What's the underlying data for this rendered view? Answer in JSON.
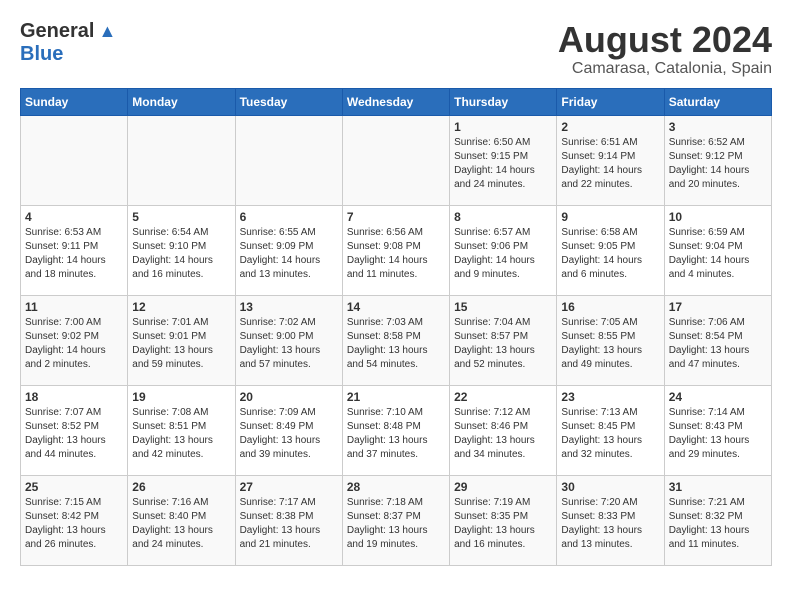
{
  "header": {
    "logo_general": "General",
    "logo_blue": "Blue",
    "main_title": "August 2024",
    "subtitle": "Camarasa, Catalonia, Spain"
  },
  "calendar": {
    "days_of_week": [
      "Sunday",
      "Monday",
      "Tuesday",
      "Wednesday",
      "Thursday",
      "Friday",
      "Saturday"
    ],
    "weeks": [
      [
        {
          "day": "",
          "info": ""
        },
        {
          "day": "",
          "info": ""
        },
        {
          "day": "",
          "info": ""
        },
        {
          "day": "",
          "info": ""
        },
        {
          "day": "1",
          "info": "Sunrise: 6:50 AM\nSunset: 9:15 PM\nDaylight: 14 hours\nand 24 minutes."
        },
        {
          "day": "2",
          "info": "Sunrise: 6:51 AM\nSunset: 9:14 PM\nDaylight: 14 hours\nand 22 minutes."
        },
        {
          "day": "3",
          "info": "Sunrise: 6:52 AM\nSunset: 9:12 PM\nDaylight: 14 hours\nand 20 minutes."
        }
      ],
      [
        {
          "day": "4",
          "info": "Sunrise: 6:53 AM\nSunset: 9:11 PM\nDaylight: 14 hours\nand 18 minutes."
        },
        {
          "day": "5",
          "info": "Sunrise: 6:54 AM\nSunset: 9:10 PM\nDaylight: 14 hours\nand 16 minutes."
        },
        {
          "day": "6",
          "info": "Sunrise: 6:55 AM\nSunset: 9:09 PM\nDaylight: 14 hours\nand 13 minutes."
        },
        {
          "day": "7",
          "info": "Sunrise: 6:56 AM\nSunset: 9:08 PM\nDaylight: 14 hours\nand 11 minutes."
        },
        {
          "day": "8",
          "info": "Sunrise: 6:57 AM\nSunset: 9:06 PM\nDaylight: 14 hours\nand 9 minutes."
        },
        {
          "day": "9",
          "info": "Sunrise: 6:58 AM\nSunset: 9:05 PM\nDaylight: 14 hours\nand 6 minutes."
        },
        {
          "day": "10",
          "info": "Sunrise: 6:59 AM\nSunset: 9:04 PM\nDaylight: 14 hours\nand 4 minutes."
        }
      ],
      [
        {
          "day": "11",
          "info": "Sunrise: 7:00 AM\nSunset: 9:02 PM\nDaylight: 14 hours\nand 2 minutes."
        },
        {
          "day": "12",
          "info": "Sunrise: 7:01 AM\nSunset: 9:01 PM\nDaylight: 13 hours\nand 59 minutes."
        },
        {
          "day": "13",
          "info": "Sunrise: 7:02 AM\nSunset: 9:00 PM\nDaylight: 13 hours\nand 57 minutes."
        },
        {
          "day": "14",
          "info": "Sunrise: 7:03 AM\nSunset: 8:58 PM\nDaylight: 13 hours\nand 54 minutes."
        },
        {
          "day": "15",
          "info": "Sunrise: 7:04 AM\nSunset: 8:57 PM\nDaylight: 13 hours\nand 52 minutes."
        },
        {
          "day": "16",
          "info": "Sunrise: 7:05 AM\nSunset: 8:55 PM\nDaylight: 13 hours\nand 49 minutes."
        },
        {
          "day": "17",
          "info": "Sunrise: 7:06 AM\nSunset: 8:54 PM\nDaylight: 13 hours\nand 47 minutes."
        }
      ],
      [
        {
          "day": "18",
          "info": "Sunrise: 7:07 AM\nSunset: 8:52 PM\nDaylight: 13 hours\nand 44 minutes."
        },
        {
          "day": "19",
          "info": "Sunrise: 7:08 AM\nSunset: 8:51 PM\nDaylight: 13 hours\nand 42 minutes."
        },
        {
          "day": "20",
          "info": "Sunrise: 7:09 AM\nSunset: 8:49 PM\nDaylight: 13 hours\nand 39 minutes."
        },
        {
          "day": "21",
          "info": "Sunrise: 7:10 AM\nSunset: 8:48 PM\nDaylight: 13 hours\nand 37 minutes."
        },
        {
          "day": "22",
          "info": "Sunrise: 7:12 AM\nSunset: 8:46 PM\nDaylight: 13 hours\nand 34 minutes."
        },
        {
          "day": "23",
          "info": "Sunrise: 7:13 AM\nSunset: 8:45 PM\nDaylight: 13 hours\nand 32 minutes."
        },
        {
          "day": "24",
          "info": "Sunrise: 7:14 AM\nSunset: 8:43 PM\nDaylight: 13 hours\nand 29 minutes."
        }
      ],
      [
        {
          "day": "25",
          "info": "Sunrise: 7:15 AM\nSunset: 8:42 PM\nDaylight: 13 hours\nand 26 minutes."
        },
        {
          "day": "26",
          "info": "Sunrise: 7:16 AM\nSunset: 8:40 PM\nDaylight: 13 hours\nand 24 minutes."
        },
        {
          "day": "27",
          "info": "Sunrise: 7:17 AM\nSunset: 8:38 PM\nDaylight: 13 hours\nand 21 minutes."
        },
        {
          "day": "28",
          "info": "Sunrise: 7:18 AM\nSunset: 8:37 PM\nDaylight: 13 hours\nand 19 minutes."
        },
        {
          "day": "29",
          "info": "Sunrise: 7:19 AM\nSunset: 8:35 PM\nDaylight: 13 hours\nand 16 minutes."
        },
        {
          "day": "30",
          "info": "Sunrise: 7:20 AM\nSunset: 8:33 PM\nDaylight: 13 hours\nand 13 minutes."
        },
        {
          "day": "31",
          "info": "Sunrise: 7:21 AM\nSunset: 8:32 PM\nDaylight: 13 hours\nand 11 minutes."
        }
      ]
    ]
  }
}
